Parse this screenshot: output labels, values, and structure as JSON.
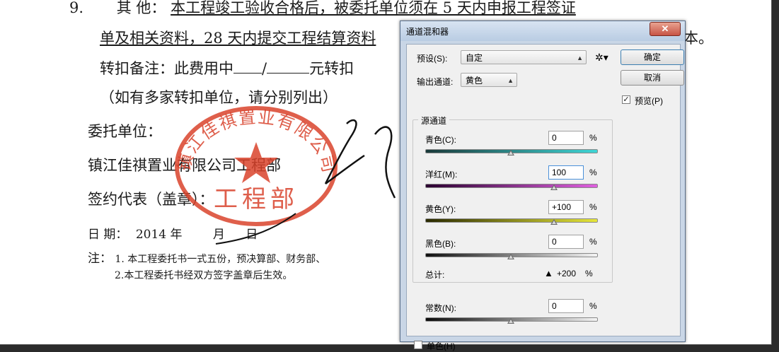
{
  "document": {
    "line1": {
      "num": "9.",
      "label": "其     他：",
      "text": "本工程竣工验收合格后，被委托单位须在 5 天内申报工程签证"
    },
    "line2": {
      "text": "单及相关资料，28 天内提交工程结算资料",
      "tail": "本。"
    },
    "line3": {
      "label": "转扣备注：此费用中",
      "sep": "/",
      "tail": "元转扣"
    },
    "line4": "（如有多家转扣单位，请分别列出）",
    "line5": "委托单位：",
    "line6": "镇江佳祺置业有限公司工程部",
    "line7": "签约代表（盖章）：",
    "date": {
      "label": "日      期：",
      "year": "2014 年",
      "month_suffix": "月",
      "day_suffix": "日"
    },
    "notes": {
      "prefix": "注：",
      "item1": "1. 本工程委托书一式五份，预决算部、财务部、",
      "item2": "2.本工程委托书经双方签字盖章后生效。"
    },
    "stamp": {
      "ring_text": "镇江佳祺置业有限公司",
      "center_text": "工程部",
      "color": "#d9432c"
    }
  },
  "dialog": {
    "title": "通道混和器",
    "close_label": "✕",
    "preset": {
      "label": "预设(S):",
      "value": "自定",
      "gear_icon": "gear-icon"
    },
    "output": {
      "label": "输出通道:",
      "value": "黄色"
    },
    "buttons": {
      "ok": "确定",
      "cancel": "取消",
      "preview": "预览(P)",
      "preview_checked": true
    },
    "source_group_title": "源通道",
    "channels": [
      {
        "label": "青色(C):",
        "value": "0",
        "percent": "%",
        "position": 50,
        "gradient": [
          "#1a3a3a",
          "#3fd6d6"
        ]
      },
      {
        "label": "洋红(M):",
        "value": "100",
        "percent": "%",
        "position": 75,
        "gradient": [
          "#2a0030",
          "#e060e0"
        ]
      },
      {
        "label": "黄色(Y):",
        "value": "+100",
        "percent": "%",
        "position": 75,
        "gradient": [
          "#2a2a00",
          "#e6e63a"
        ]
      },
      {
        "label": "黑色(B):",
        "value": "0",
        "percent": "%",
        "position": 50,
        "gradient": [
          "#101010",
          "#f4f4f4"
        ]
      }
    ],
    "total": {
      "label": "总计:",
      "warning_icon": "warning-icon",
      "value": "+200",
      "percent": "%"
    },
    "constant": {
      "label": "常数(N):",
      "value": "0",
      "percent": "%",
      "position": 50
    },
    "monochrome": {
      "label": "单色(H)",
      "checked": false
    }
  }
}
